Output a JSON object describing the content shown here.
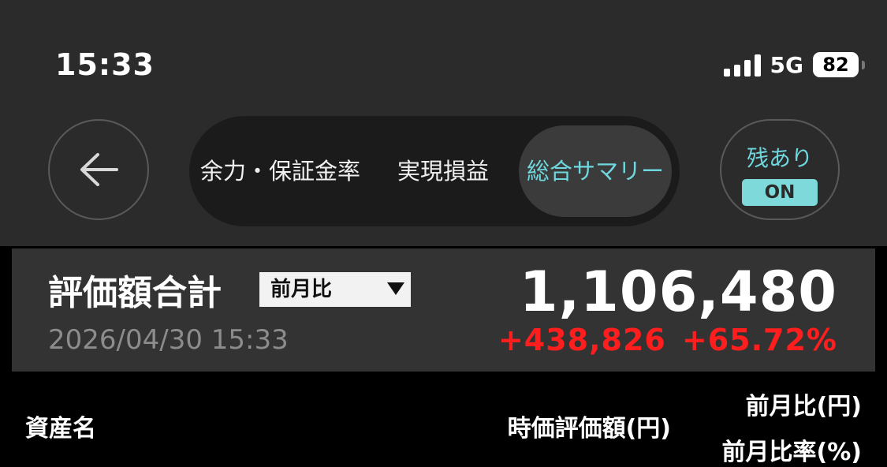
{
  "status_bar": {
    "time": "15:33",
    "network": "5G",
    "battery": "82"
  },
  "nav": {
    "back_icon": "arrow-left-icon",
    "tabs": [
      {
        "label": "余力・保証金率",
        "active": false
      },
      {
        "label": "実現損益",
        "active": false
      },
      {
        "label": "総合サマリー",
        "active": true
      }
    ],
    "remaining_filter": {
      "label": "残あり",
      "state": "ON"
    }
  },
  "summary": {
    "title": "評価額合計",
    "compare_option": "前月比",
    "date": "2026/04/30 15:33",
    "total_value": "1,106,480",
    "change_amount": "+438,826",
    "change_rate": "+65.72%"
  },
  "table_header": {
    "asset_name": "資産名",
    "market_value": "時価評価額(円)",
    "monthly_diff": "前月比(円)",
    "monthly_rate": "前月比率(%)"
  },
  "colors": {
    "accent": "#6fd7dd",
    "negative_or_gain": "#ff1e1e",
    "panel": "#333333"
  }
}
